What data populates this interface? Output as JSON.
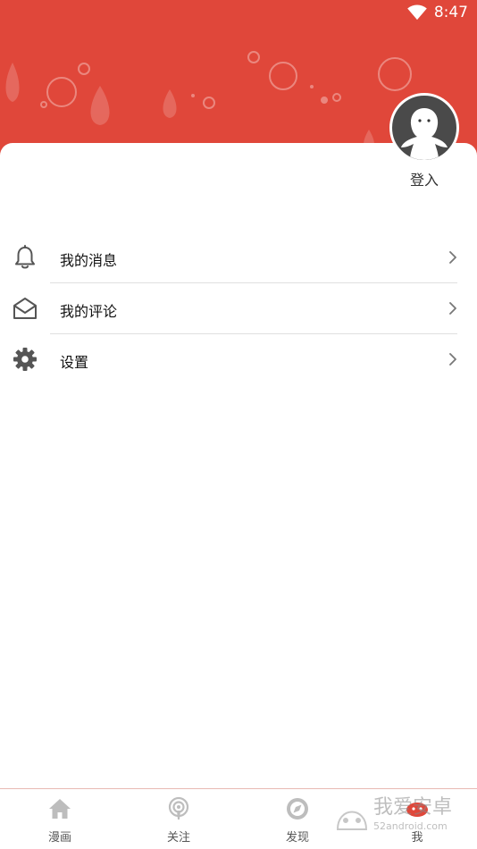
{
  "status_bar": {
    "time": "8:47"
  },
  "profile": {
    "login_label": "登入"
  },
  "menu": [
    {
      "label": "我的消息",
      "icon": "bell-icon"
    },
    {
      "label": "我的评论",
      "icon": "mail-open-icon"
    },
    {
      "label": "设置",
      "icon": "gear-icon"
    }
  ],
  "bottom_nav": [
    {
      "label": "漫画",
      "icon": "home-icon"
    },
    {
      "label": "关注",
      "icon": "podcast-icon"
    },
    {
      "label": "发现",
      "icon": "compass-icon"
    },
    {
      "label": "我",
      "icon": "user-icon",
      "active": true
    }
  ],
  "watermark": {
    "text": "我爱安卓",
    "subtext": "52android.com"
  },
  "colors": {
    "brand": "#e0473a",
    "text": "#111111",
    "muted": "#555555"
  }
}
